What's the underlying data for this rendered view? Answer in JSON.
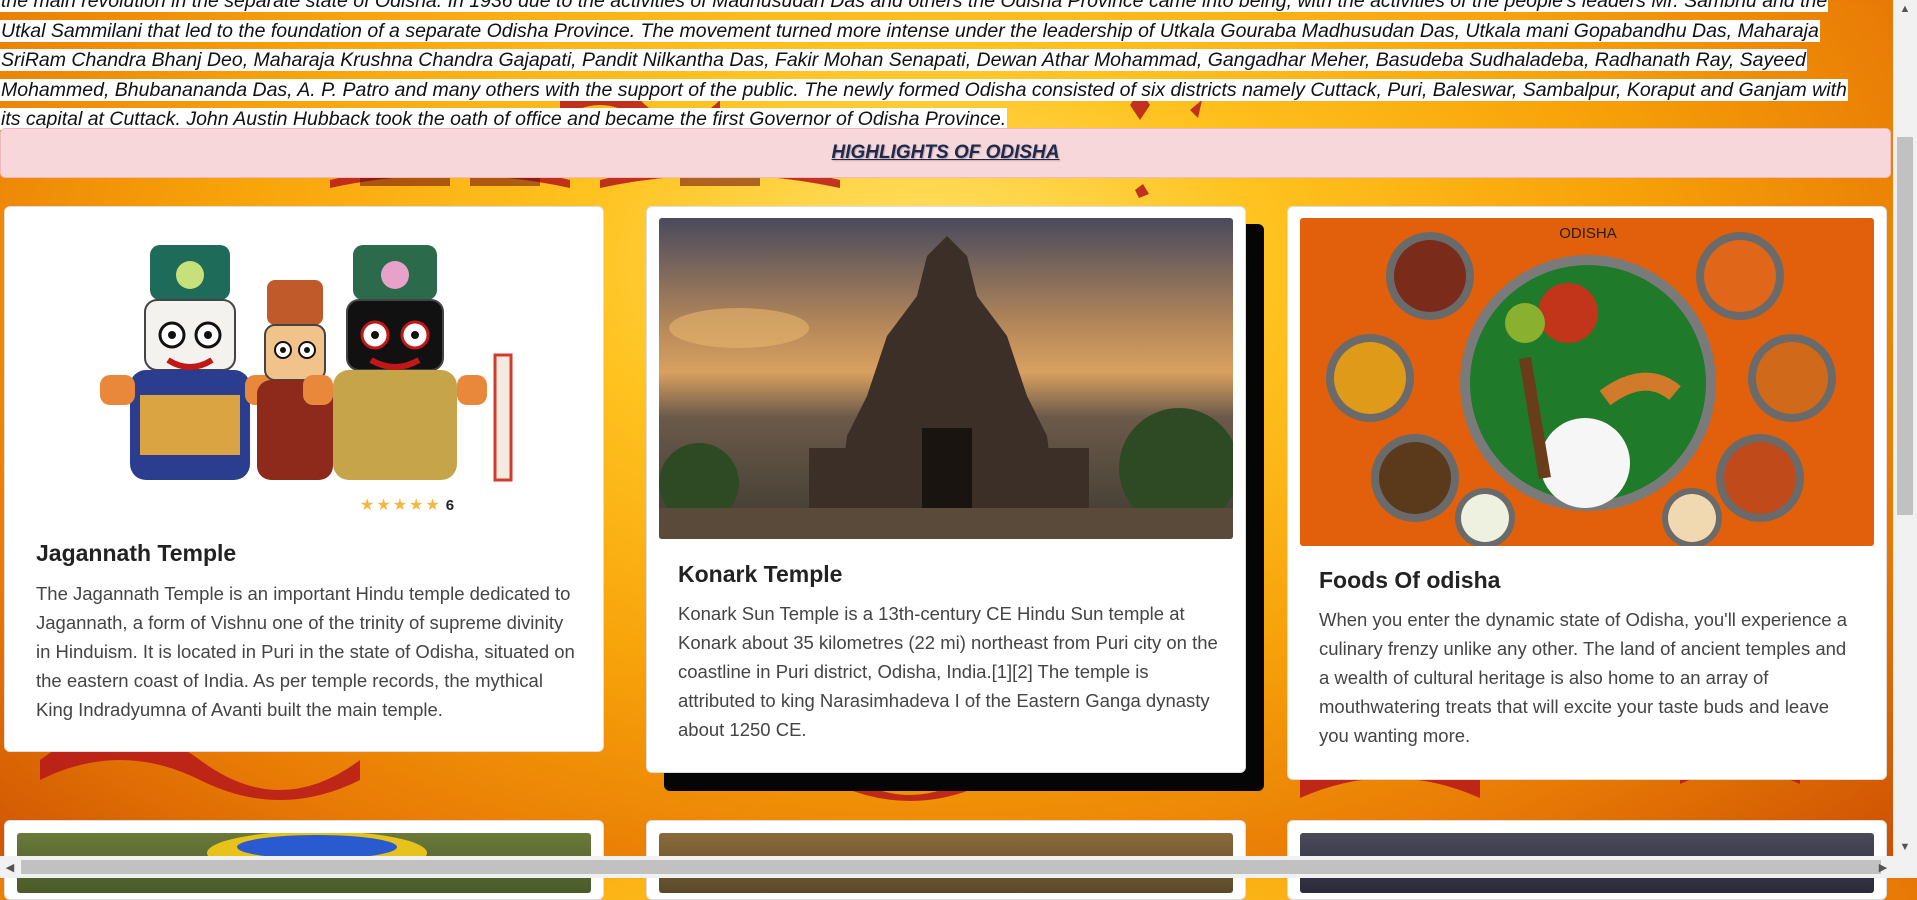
{
  "intro": {
    "paragraph": "the main revolution in the separate state of Odisha. In 1936 due to the activities of Madhusudan Das and others the Odisha Province came into being, with the activities of the people's leaders Mr. Sambhu and the Utkal Sammilani that led to the foundation of a separate Odisha Province. The movement turned more intense under the leadership of Utkala Gouraba Madhusudan Das, Utkala mani Gopabandhu Das, Maharaja SriRam Chandra Bhanj Deo, Maharaja Krushna Chandra Gajapati, Pandit Nilkantha Das, Fakir Mohan Senapati, Dewan Athar Mohammad, Gangadhar Meher, Basudeba Sudhaladeba, Radhanath Ray, Sayeed Mohammed, Bhubanananda Das, A. P. Patro and many others with the support of the public. The newly formed Odisha consisted of six districts namely Cuttack, Puri, Baleswar, Sambalpur, Koraput and Ganjam with its capital at Cuttack. John Austin Hubback took the oath of office and became the first Governor of Odisha Province."
  },
  "highlights": {
    "title": "HIGHLIGHTS OF ODISHA"
  },
  "cards": [
    {
      "title": "Jagannath Temple",
      "rating_count": "6",
      "rating_stars": 5,
      "description": "The Jagannath Temple is an important Hindu temple dedicated to Jagannath, a form of Vishnu one of the trinity of supreme divinity in Hinduism. It is located in Puri in the state of Odisha, situated on the eastern coast of India. As per temple records, the mythical King Indradyumna of Avanti built the main temple."
    },
    {
      "title": "Konark Temple",
      "description": "Konark Sun Temple is a 13th-century CE Hindu Sun temple at Konark about 35 kilometres (22 mi) northeast from Puri city on the coastline in Puri district, Odisha, India.[1][2] The temple is attributed to king Narasimhadeva I of the Eastern Ganga dynasty about 1250 CE."
    },
    {
      "title": "Foods Of odisha",
      "image_caption": "ODISHA",
      "description": "When you enter the dynamic state of Odisha, you'll experience a culinary frenzy unlike any other. The land of ancient temples and a wealth of cultural heritage is also home to an array of mouthwatering treats that will excite your taste buds and leave you wanting more."
    }
  ],
  "colors": {
    "highlight_bg": "#f8d7da",
    "star": "#f5b642",
    "page_bg": "#f7a20a"
  }
}
